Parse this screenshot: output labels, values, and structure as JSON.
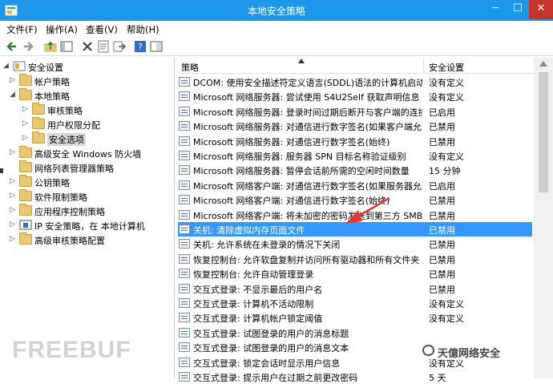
{
  "window": {
    "title": "本地安全策略"
  },
  "window_buttons": {
    "minimize": "─",
    "maximize": "☐",
    "close": "✕"
  },
  "menu": [
    "文件(F)",
    "操作(A)",
    "查看(V)",
    "帮助(H)"
  ],
  "toolbar_icons": [
    "back-icon",
    "forward-icon",
    "up-folder-icon",
    "show-tree-icon",
    "delete-icon",
    "properties-icon",
    "export-icon",
    "help-icon",
    "view-icon"
  ],
  "tree": [
    {
      "label": "安全设置",
      "level": 0,
      "expander": "◢",
      "icon": "security-settings-icon"
    },
    {
      "label": "帐户策略",
      "level": 1,
      "expander": "▷",
      "icon": "folder-icon"
    },
    {
      "label": "本地策略",
      "level": 1,
      "expander": "◢",
      "icon": "folder-icon"
    },
    {
      "label": "审核策略",
      "level": 2,
      "expander": "▷",
      "icon": "folder-lock-icon"
    },
    {
      "label": "用户权限分配",
      "level": 2,
      "expander": "▷",
      "icon": "folder-lock-icon"
    },
    {
      "label": "安全选项",
      "level": 2,
      "expander": "▷",
      "icon": "folder-lock-icon",
      "selected": true
    },
    {
      "label": "高级安全 Windows 防火墙",
      "level": 1,
      "expander": "▷",
      "icon": "folder-icon"
    },
    {
      "label": "网络列表管理器策略",
      "level": 1,
      "expander": "",
      "icon": "folder-icon"
    },
    {
      "label": "公钥策略",
      "level": 1,
      "expander": "▷",
      "icon": "folder-icon"
    },
    {
      "label": "软件限制策略",
      "level": 1,
      "expander": "▷",
      "icon": "folder-icon"
    },
    {
      "label": "应用程序控制策略",
      "level": 1,
      "expander": "▷",
      "icon": "folder-icon"
    },
    {
      "label": "IP 安全策略，在 本地计算机",
      "level": 1,
      "expander": "▷",
      "icon": "ip-security-icon"
    },
    {
      "label": "高级审核策略配置",
      "level": 1,
      "expander": "▷",
      "icon": "folder-icon"
    }
  ],
  "list": {
    "col_policy": "策略",
    "col_setting": "安全设置",
    "rows": [
      {
        "policy": "DCOM: 使用安全描述符定义语言(SDDL)语法的计算机启动...",
        "setting": "没有定义"
      },
      {
        "policy": "Microsoft 网络服务器: 尝试使用 S4U2Self 获取声明信息",
        "setting": "没有定义"
      },
      {
        "policy": "Microsoft 网络服务器: 登录时间过期后断开与客户端的连接",
        "setting": "已启用"
      },
      {
        "policy": "Microsoft 网络服务器: 对通信进行数字签名(如果客户端允...",
        "setting": "已禁用"
      },
      {
        "policy": "Microsoft 网络服务器: 对通信进行数字签名(始终)",
        "setting": "已禁用"
      },
      {
        "policy": "Microsoft 网络服务器: 服务器 SPN 目标名称验证级别",
        "setting": "没有定义"
      },
      {
        "policy": "Microsoft 网络服务器: 暂停会话前所需的空闲时间数量",
        "setting": "15 分钟"
      },
      {
        "policy": "Microsoft 网络客户端: 对通信进行数字签名(如果服务器允...",
        "setting": "已启用"
      },
      {
        "policy": "Microsoft 网络客户端: 对通信进行数字签名(始终)",
        "setting": "已禁用"
      },
      {
        "policy": "Microsoft 网络客户端: 将未加密的密码发送到第三方 SMB...",
        "setting": "已禁用"
      },
      {
        "policy": "关机: 清除虚拟内存页面文件",
        "setting": "已禁用",
        "selected": true
      },
      {
        "policy": "关机: 允许系统在未登录的情况下关闭",
        "setting": "已禁用"
      },
      {
        "policy": "恢复控制台: 允许软盘复制并访问所有驱动器和所有文件夹",
        "setting": "已禁用"
      },
      {
        "policy": "恢复控制台: 允许自动管理登录",
        "setting": "已禁用"
      },
      {
        "policy": "交互式登录: 不显示最后的用户名",
        "setting": "已禁用"
      },
      {
        "policy": "交互式登录: 计算机不活动限制",
        "setting": "没有定义"
      },
      {
        "policy": "交互式登录: 计算机帐户锁定阈值",
        "setting": "没有定义"
      },
      {
        "policy": "交互式登录: 试图登录的用户的消息标题",
        "setting": ""
      },
      {
        "policy": "交互式登录: 试图登录的用户的消息文本",
        "setting": ""
      },
      {
        "policy": "交互式登录: 锁定会话时显示用户信息",
        "setting": "没有定义"
      },
      {
        "policy": "交互式登录: 提示用户在过期之前更改密码",
        "setting": "5 天"
      }
    ]
  },
  "watermarks": {
    "left": "FREEBUF",
    "right": "天億网络安全"
  },
  "colors": {
    "titlebar": "#1c97ea",
    "selection": "#3399ff",
    "annotation_arrow": "#e53935"
  }
}
